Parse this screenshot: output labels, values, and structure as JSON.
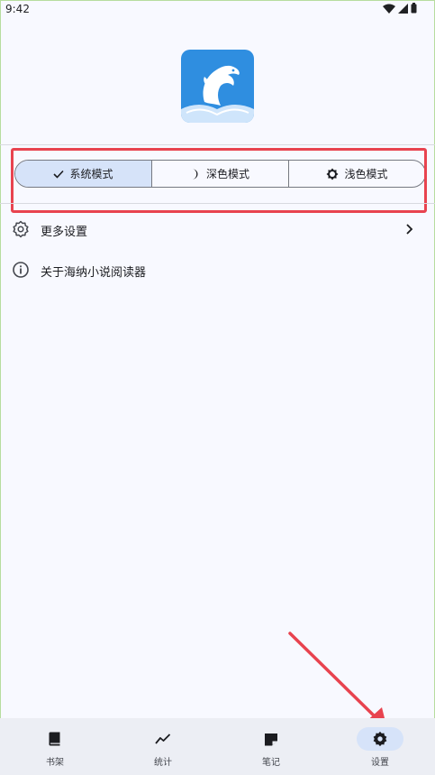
{
  "status_bar": {
    "time": "9:42"
  },
  "theme_modes": [
    {
      "label": "系统模式",
      "icon": "check-icon",
      "selected": true
    },
    {
      "label": "深色模式",
      "icon": "moon-icon",
      "selected": false
    },
    {
      "label": "浅色模式",
      "icon": "sun-icon",
      "selected": false
    }
  ],
  "menu": [
    {
      "label": "更多设置",
      "icon": "gear-outline-icon",
      "chevron": true
    },
    {
      "label": "关于海纳小说阅读器",
      "icon": "info-icon",
      "chevron": false
    }
  ],
  "bottom_nav": [
    {
      "label": "书架",
      "icon": "book-icon",
      "active": false
    },
    {
      "label": "统计",
      "icon": "trend-icon",
      "active": false
    },
    {
      "label": "笔记",
      "icon": "note-icon",
      "active": false
    },
    {
      "label": "设置",
      "icon": "gear-icon",
      "active": true
    }
  ],
  "colors": {
    "background": "#f8f9ff",
    "selected_segment": "#d6e3f9",
    "highlight_annotation": "#e8434f",
    "logo_blue": "#2f8ee0"
  }
}
